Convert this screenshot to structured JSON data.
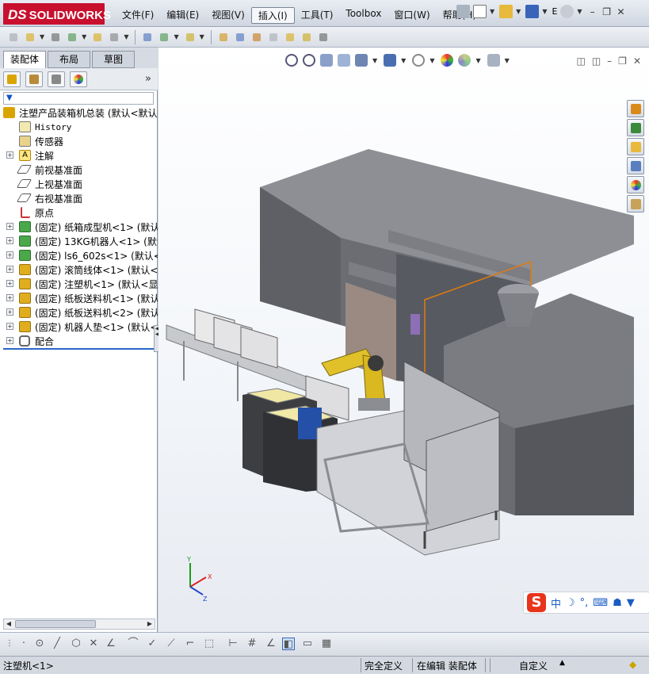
{
  "app": {
    "logo_text": "SOLIDWORKS",
    "logo_prefix": "DS"
  },
  "menus": [
    {
      "label": "文件(F)"
    },
    {
      "label": "编辑(E)"
    },
    {
      "label": "视图(V)"
    },
    {
      "label": "插入(I)",
      "active": true
    },
    {
      "label": "工具(T)"
    },
    {
      "label": "Toolbox"
    },
    {
      "label": "窗口(W)"
    },
    {
      "label": "帮助(H)"
    }
  ],
  "title_right_text": "E",
  "feature_manager": {
    "tabs": [
      "装配体",
      "布局",
      "草图"
    ],
    "active_tab": "装配体",
    "root": "注塑产品装箱机总装  (默认<默认",
    "items": [
      {
        "label": "History",
        "icon": "history-icon"
      },
      {
        "label": "传感器",
        "icon": "sensor-icon"
      },
      {
        "label": "注解",
        "icon": "annotation-icon",
        "expandable": true
      },
      {
        "label": "前视基准面",
        "icon": "plane-icon"
      },
      {
        "label": "上视基准面",
        "icon": "plane-icon"
      },
      {
        "label": "右视基准面",
        "icon": "plane-icon"
      },
      {
        "label": "原点",
        "icon": "origin-icon"
      },
      {
        "label": "(固定) 纸箱成型机<1> (默认",
        "icon": "subassembly-icon",
        "expandable": true
      },
      {
        "label": "(固定) 13KG机器人<1> (默认",
        "icon": "subassembly-icon",
        "expandable": true
      },
      {
        "label": "(固定) ls6_602s<1> (默认<",
        "icon": "subassembly-icon",
        "expandable": true
      },
      {
        "label": "(固定) 滚筒线体<1> (默认<",
        "icon": "subassembly-icon",
        "expandable": true
      },
      {
        "label": "(固定) 注塑机<1> (默认<显",
        "icon": "subassembly-icon",
        "expandable": true
      },
      {
        "label": "(固定) 纸板送料机<1> (默认",
        "icon": "subassembly-icon",
        "expandable": true
      },
      {
        "label": "(固定) 纸板送料机<2> (默认",
        "icon": "subassembly-icon",
        "expandable": true
      },
      {
        "label": "(固定) 机器人垫<1> (默认<",
        "icon": "subassembly-icon",
        "expandable": true
      },
      {
        "label": "配合",
        "icon": "mates-icon",
        "expandable": true
      }
    ]
  },
  "ime": {
    "logo": "S",
    "mode": "中"
  },
  "status": {
    "selection": "注塑机<1>",
    "definition": "完全定义",
    "editing": "在编辑 装配体",
    "units": "自定义"
  },
  "colors": {
    "accent": "#c8102e",
    "selection_blue": "#2a67c9"
  }
}
